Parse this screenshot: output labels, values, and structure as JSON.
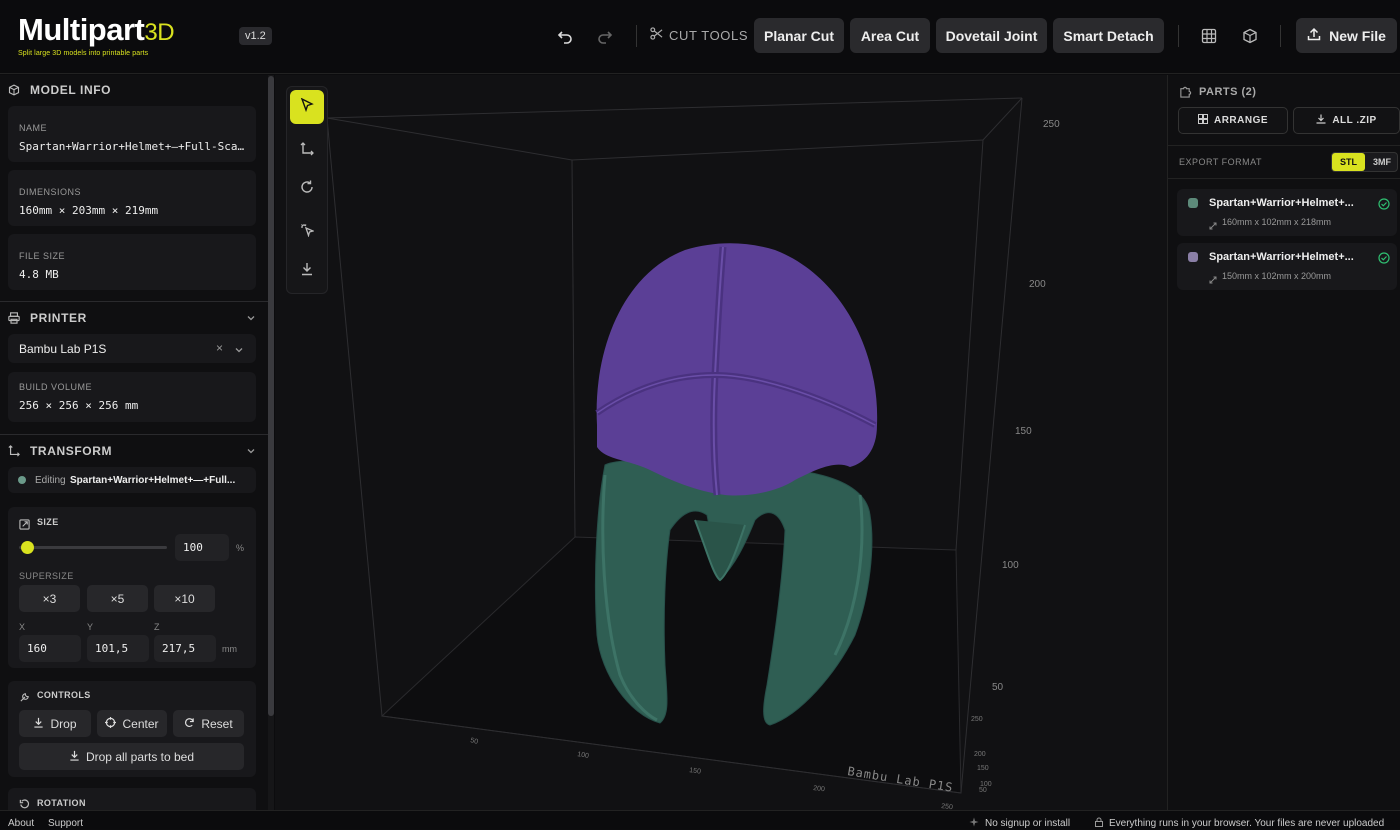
{
  "app": {
    "brand": "Multipart",
    "brand_suffix": "3D",
    "tagline": "Split large 3D models into printable parts",
    "version": "v1.2",
    "accent": "#d9e21f"
  },
  "toolbar": {
    "cut_tools_label": "CUT TOOLS",
    "buttons": [
      "Planar Cut",
      "Area Cut",
      "Dovetail Joint",
      "Smart Detach"
    ],
    "new_file_label": "New File"
  },
  "model_info": {
    "header": "MODEL INFO",
    "name_label": "NAME",
    "name_value": "Spartan+Warrior+Helmet+—+Full-Scale",
    "dimensions_label": "DIMENSIONS",
    "dimensions_value": "160mm × 203mm × 219mm",
    "file_size_label": "FILE SIZE",
    "file_size_value": "4.8 MB"
  },
  "printer": {
    "header": "PRINTER",
    "selected": "Bambu Lab P1S",
    "build_volume_label": "BUILD VOLUME",
    "build_volume_value": "256 × 256 × 256 mm"
  },
  "transform": {
    "header": "TRANSFORM",
    "editing_prefix": "Editing",
    "editing_part": "Spartan+Warrior+Helmet+—+Full...",
    "size_label": "SIZE",
    "size_value": "100",
    "size_unit": "%",
    "size_slider_fraction": 0.0,
    "supersize_label": "SUPERSIZE",
    "supersize_options": [
      "×3",
      "×5",
      "×10"
    ],
    "x_label": "X",
    "x_value": "160",
    "y_label": "Y",
    "y_value": "101,5",
    "z_label": "Z",
    "z_value": "217,5",
    "dim_unit": "mm",
    "controls_label": "CONTROLS",
    "drop_label": "Drop",
    "center_label": "Center",
    "reset_label": "Reset",
    "drop_all_label": "Drop all parts to bed",
    "rotation_label": "ROTATION"
  },
  "viewport": {
    "printer_label": "Bambu Lab P1S",
    "z_ticks": [
      "250",
      "200",
      "150",
      "100",
      "50"
    ],
    "x_ticks": [
      "50",
      "100",
      "150",
      "200",
      "250"
    ],
    "y_ticks": [
      "50",
      "100",
      "150",
      "200",
      "250"
    ],
    "part_colors": [
      "#5b3f96",
      "#2f5e53"
    ]
  },
  "parts": {
    "header": "PARTS (2)",
    "arrange_label": "ARRANGE",
    "all_zip_label": "ALL .ZIP",
    "export_format_label": "EXPORT FORMAT",
    "formats": [
      "STL",
      "3MF"
    ],
    "selected_format": "STL",
    "items": [
      {
        "name": "Spartan+Warrior+Helmet+...",
        "dims": "160mm x 102mm x 218mm",
        "color": "#5d8a7a"
      },
      {
        "name": "Spartan+Warrior+Helmet+...",
        "dims": "150mm x 102mm x 200mm",
        "color": "#8a7fa6"
      }
    ]
  },
  "footer": {
    "about": "About",
    "support": "Support",
    "no_signup": "No signup or install",
    "privacy": "Everything runs in your browser. Your files are never uploaded"
  }
}
